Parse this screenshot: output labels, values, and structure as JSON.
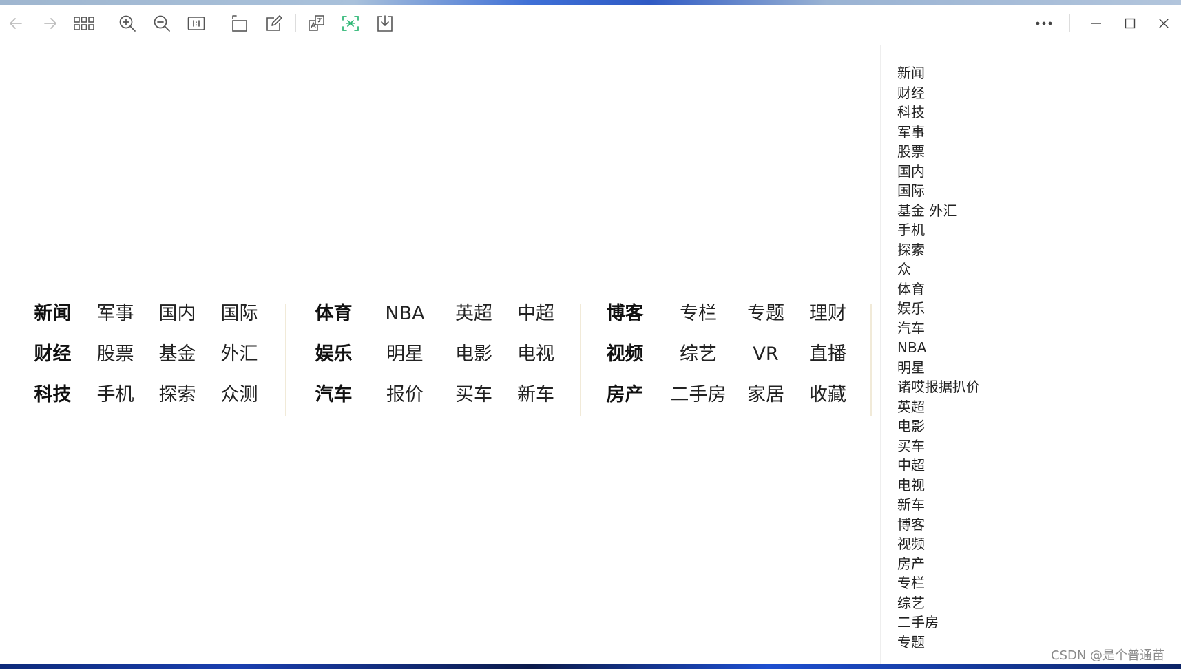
{
  "nav": {
    "groups": [
      {
        "rows": [
          [
            "新闻",
            "军事",
            "国内",
            "国际"
          ],
          [
            "财经",
            "股票",
            "基金",
            "外汇"
          ],
          [
            "科技",
            "手机",
            "探索",
            "众测"
          ]
        ]
      },
      {
        "rows": [
          [
            "体育",
            "NBA",
            "英超",
            "中超"
          ],
          [
            "娱乐",
            "明星",
            "电影",
            "电视"
          ],
          [
            "汽车",
            "报价",
            "买车",
            "新车"
          ]
        ]
      },
      {
        "rows": [
          [
            "博客",
            "专栏",
            "专题",
            "理财"
          ],
          [
            "视频",
            "综艺",
            "VR",
            "直播"
          ],
          [
            "房产",
            "二手房",
            "家居",
            "收藏"
          ]
        ]
      }
    ],
    "divider_color": "#f1ead8"
  },
  "sidebar": {
    "items": [
      "新闻",
      "财经",
      "科技",
      "军事",
      "股票",
      "国内",
      "国际",
      "基金 外汇",
      "手机",
      "探索",
      "众",
      "体育",
      "娱乐",
      "汽车",
      "NBA",
      "明星",
      "诸哎报据扒价",
      "英超",
      "电影",
      "买车",
      "中超",
      "电视",
      "新车",
      "博客",
      "视频",
      "房产",
      "专栏",
      "综艺",
      "二手房",
      "专题"
    ]
  },
  "toolbar": {
    "icons": [
      "back-arrow-icon",
      "forward-arrow-icon",
      "grid-icon",
      "zoom-in-icon",
      "zoom-out-icon",
      "actual-size-icon",
      "rotate-icon",
      "edit-icon",
      "translate-icon",
      "ocr-icon",
      "download-icon",
      "more-icon",
      "minimize-icon",
      "maximize-icon",
      "close-icon"
    ],
    "accent_color": "#2bb673"
  },
  "watermark": "CSDN @是个普通苗"
}
